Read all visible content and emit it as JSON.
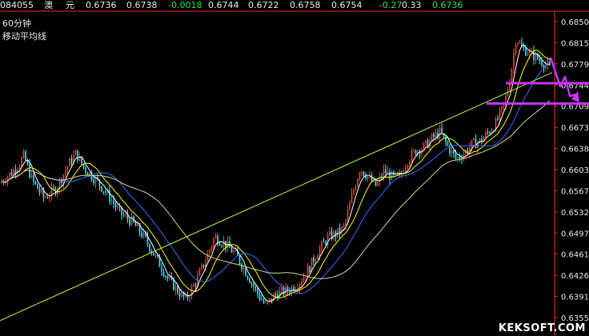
{
  "quote_bar": {
    "code": "084055",
    "name_a": "澳",
    "name_b": "元",
    "v1": "0.6736",
    "v2": "0.6738",
    "change": "-0.0018",
    "v3": "0.6744",
    "v4": "0.6722",
    "v5": "0.6758",
    "v6": "0.6754",
    "pct": "-0.27",
    "v7": "0.33",
    "last": "0.6736"
  },
  "labels": {
    "timeframe": "60分钟",
    "indicator": "移动平均线"
  },
  "watermark": "KEKSOFT.COM",
  "colors": {
    "background": "#000000",
    "bull_candle": "#ff3b30",
    "bear_candle": "#00ffff",
    "ma_short": "#ffffff",
    "ma_mid": "#ffff00",
    "ma_blue": "#3d6bff",
    "ma_long": "#d8d890",
    "trendline": "#b8ff3c",
    "annotation": "#cc33ff"
  },
  "chart_data": {
    "type": "line",
    "ylim": [
      0.6345,
      0.686
    ],
    "y_ticks": [
      "0.6850",
      "0.6815",
      "0.6779",
      "0.6744",
      "0.6709",
      "0.6673",
      "0.6638",
      "0.6603",
      "0.6567",
      "0.6532",
      "0.6497",
      "0.6461",
      "0.6426",
      "0.6391",
      "0.6355"
    ],
    "price_anchors": [
      [
        0,
        0.658
      ],
      [
        20,
        0.6605
      ],
      [
        30,
        0.6625
      ],
      [
        40,
        0.6585
      ],
      [
        55,
        0.6555
      ],
      [
        70,
        0.657
      ],
      [
        85,
        0.661
      ],
      [
        95,
        0.663
      ],
      [
        105,
        0.6605
      ],
      [
        120,
        0.6585
      ],
      [
        135,
        0.656
      ],
      [
        150,
        0.653
      ],
      [
        165,
        0.6515
      ],
      [
        180,
        0.649
      ],
      [
        195,
        0.6455
      ],
      [
        210,
        0.642
      ],
      [
        222,
        0.64
      ],
      [
        232,
        0.6385
      ],
      [
        245,
        0.6415
      ],
      [
        258,
        0.6455
      ],
      [
        268,
        0.649
      ],
      [
        280,
        0.648
      ],
      [
        295,
        0.646
      ],
      [
        310,
        0.6425
      ],
      [
        322,
        0.6395
      ],
      [
        332,
        0.6375
      ],
      [
        345,
        0.6395
      ],
      [
        360,
        0.64
      ],
      [
        375,
        0.6415
      ],
      [
        385,
        0.6435
      ],
      [
        395,
        0.646
      ],
      [
        410,
        0.649
      ],
      [
        420,
        0.6495
      ],
      [
        430,
        0.6505
      ],
      [
        440,
        0.656
      ],
      [
        450,
        0.6605
      ],
      [
        460,
        0.659
      ],
      [
        470,
        0.6575
      ],
      [
        480,
        0.66
      ],
      [
        490,
        0.659
      ],
      [
        500,
        0.659
      ],
      [
        510,
        0.662
      ],
      [
        520,
        0.6635
      ],
      [
        530,
        0.664
      ],
      [
        540,
        0.6655
      ],
      [
        550,
        0.6665
      ],
      [
        560,
        0.664
      ],
      [
        570,
        0.662
      ],
      [
        580,
        0.663
      ],
      [
        590,
        0.6645
      ],
      [
        600,
        0.665
      ],
      [
        610,
        0.6665
      ],
      [
        620,
        0.668
      ],
      [
        630,
        0.671
      ],
      [
        638,
        0.676
      ],
      [
        645,
        0.6825
      ],
      [
        652,
        0.6805
      ],
      [
        660,
        0.68
      ],
      [
        670,
        0.679
      ],
      [
        680,
        0.678
      ],
      [
        690,
        0.677
      ]
    ],
    "trendline": [
      [
        0,
        0.635
      ],
      [
        690,
        0.6765
      ]
    ],
    "support_levels": [
      0.6747,
      0.6713
    ]
  }
}
